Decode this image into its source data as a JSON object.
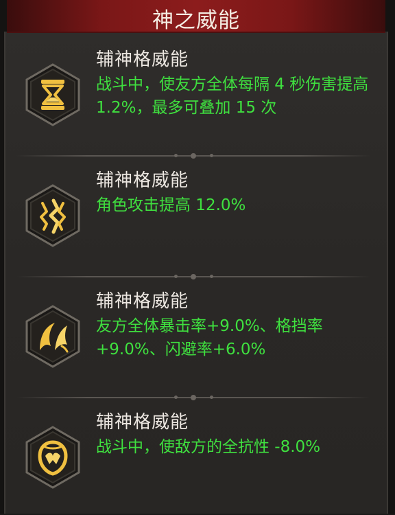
{
  "header": {
    "title": "神之威能"
  },
  "skills": [
    {
      "title": "辅神格威能",
      "desc": "战斗中，使友方全体每隔 4 秒伤害提高 1.2%，最多可叠加 15 次",
      "icon": "hourglass-icon"
    },
    {
      "title": "辅神格威能",
      "desc": "角色攻击提高 12.0%",
      "icon": "lightning-icon"
    },
    {
      "title": "辅神格威能",
      "desc": "友方全体暴击率+9.0%、格挡率+9.0%、闪避率+6.0%",
      "icon": "wing-icon"
    },
    {
      "title": "辅神格威能",
      "desc": "战斗中，使敌方的全抗性 -8.0%",
      "icon": "shield-icon"
    }
  ],
  "colors": {
    "accent_text": "#3fe03f",
    "title_text": "#ece7e1",
    "header_red": "#8c1c1c",
    "icon_gold": "#f0c040"
  }
}
